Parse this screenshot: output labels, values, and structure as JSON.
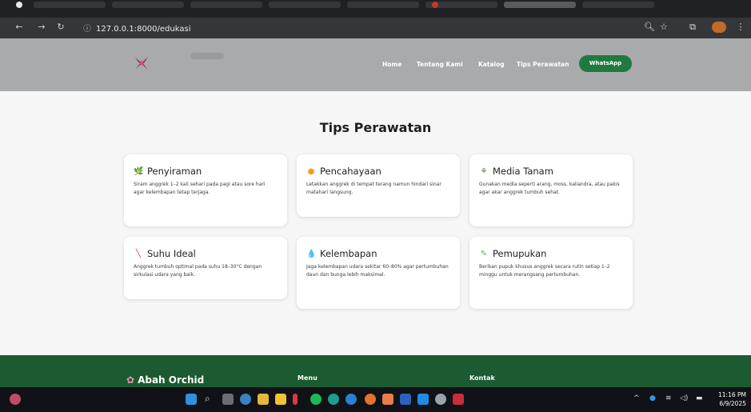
{
  "browser": {
    "url": "127.0.0.1:8000/edukasi"
  },
  "navbar": {
    "links": [
      "Home",
      "Tentang Kami",
      "Katalog",
      "Tips Perawatan"
    ],
    "whatsapp_label": "WhatsApp"
  },
  "page": {
    "title": "Tips Perawatan",
    "cards": [
      {
        "icon": "plant-sprout-icon",
        "glyph": "🌿",
        "title": "Penyiraman",
        "text": "Siram anggrek 1–2 kali sehari pada pagi atau sore hari agar kelembapan tetap terjaga."
      },
      {
        "icon": "sun-icon",
        "glyph": "●",
        "title": "Pencahayaan",
        "text": "Letakkan anggrek di tempat terang namun hindari sinar matahari langsung."
      },
      {
        "icon": "seedling-icon",
        "glyph": "⚘",
        "title": "Media Tanam",
        "text": "Gunakan media seperti arang, moss, kaliandra, atau pakis agar akar anggrek tumbuh sehat."
      },
      {
        "icon": "thermometer-icon",
        "glyph": "╲",
        "title": "Suhu Ideal",
        "text": "Anggrek tumbuh optimal pada suhu 18–30°C dengan sirkulasi udara yang baik."
      },
      {
        "icon": "droplet-icon",
        "glyph": "💧",
        "title": "Kelembapan",
        "text": "Jaga kelembapan udara sekitar 60–80% agar pertumbuhan daun dan bunga lebih maksimal."
      },
      {
        "icon": "fertilizer-icon",
        "glyph": "✎",
        "title": "Pemupukan",
        "text": "Berikan pupuk khusus anggrek secara rutin setiap 1–2 minggu untuk merangsang pertumbuhan."
      }
    ]
  },
  "footer": {
    "brand": "Abah Orchid",
    "menu_heading": "Menu",
    "contact_heading": "Kontak"
  },
  "taskbar": {
    "time": "11:16 PM",
    "date": "6/9/2025"
  },
  "colors": {
    "navbar_bg": "#a8aaac",
    "whatsapp_green": "#1f7a3f",
    "footer_green": "#1c5a31",
    "page_bg": "#f6f6f6"
  }
}
